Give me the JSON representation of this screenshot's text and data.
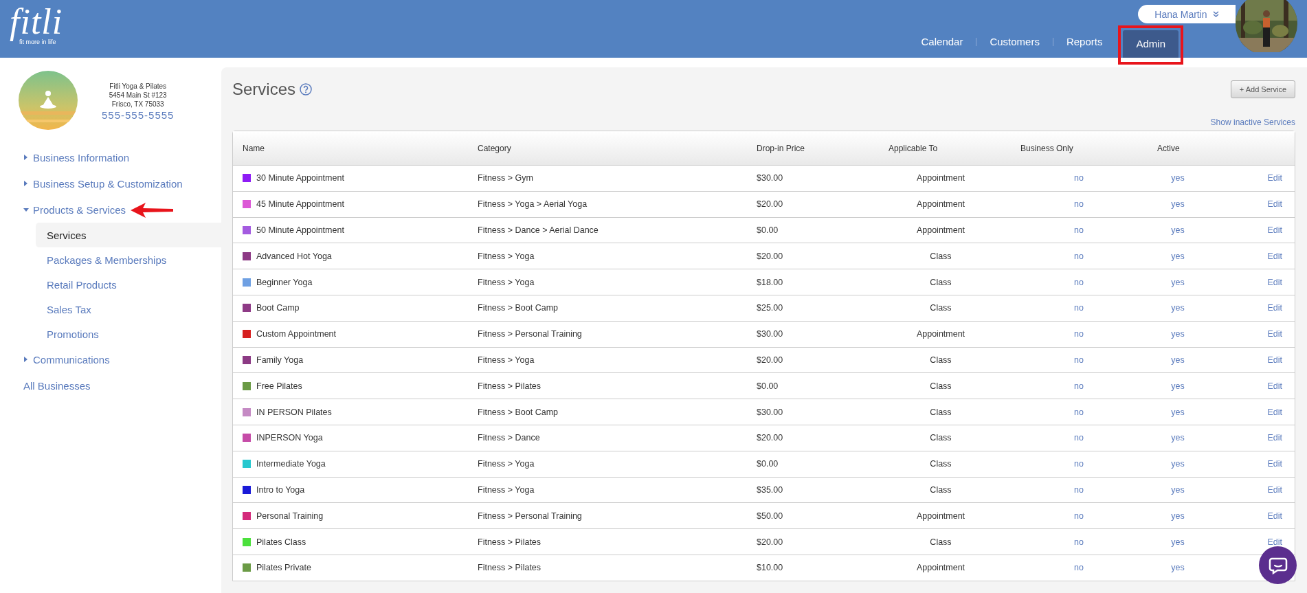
{
  "header": {
    "logo": "fitli",
    "tagline": "fit more in life",
    "user": {
      "name": "Hana Martin"
    },
    "nav": [
      {
        "label": "Calendar",
        "selected": false
      },
      {
        "label": "Customers",
        "selected": false
      },
      {
        "label": "Reports",
        "selected": false
      },
      {
        "label": "Admin",
        "selected": true,
        "highlighted": true
      }
    ]
  },
  "business": {
    "name": "Fitli Yoga & Pilates",
    "address": "5454 Main St #123",
    "city": "Frisco, TX 75033",
    "phone": "555-555-5555"
  },
  "sidebar": {
    "items": [
      {
        "kind": "group",
        "label": "Business Information",
        "expanded": false
      },
      {
        "kind": "group",
        "label": "Business Setup & Customization",
        "expanded": false
      },
      {
        "kind": "group",
        "label": "Products & Services",
        "expanded": true,
        "pointed": true,
        "children": [
          {
            "label": "Services",
            "selected": true
          },
          {
            "label": "Packages & Memberships",
            "selected": false
          },
          {
            "label": "Retail Products",
            "selected": false
          },
          {
            "label": "Sales Tax",
            "selected": false
          },
          {
            "label": "Promotions",
            "selected": false
          }
        ]
      },
      {
        "kind": "group",
        "label": "Communications",
        "expanded": false
      },
      {
        "kind": "link",
        "label": "All Businesses"
      }
    ]
  },
  "page": {
    "title": "Services",
    "add_button": "+ Add Service",
    "inactive_link": "Show inactive Services"
  },
  "table": {
    "columns": [
      "Name",
      "Category",
      "Drop-in Price",
      "Applicable To",
      "Business Only",
      "Active"
    ],
    "rows": [
      {
        "name": "30 Minute Appointment",
        "color": "#8e1cf5",
        "category": "Fitness > Gym",
        "price": "$30.00",
        "applicable": "Appointment",
        "business_only": "no",
        "active": "yes",
        "action": "Edit"
      },
      {
        "name": "45 Minute Appointment",
        "color": "#dc58d6",
        "category": "Fitness > Yoga > Aerial Yoga",
        "price": "$20.00",
        "applicable": "Appointment",
        "business_only": "no",
        "active": "yes",
        "action": "Edit"
      },
      {
        "name": "50 Minute Appointment",
        "color": "#a45be0",
        "category": "Fitness > Dance > Aerial Dance",
        "price": "$0.00",
        "applicable": "Appointment",
        "business_only": "no",
        "active": "yes",
        "action": "Edit"
      },
      {
        "name": "Advanced Hot Yoga",
        "color": "#8d3a85",
        "category": "Fitness > Yoga",
        "price": "$20.00",
        "applicable": "Class",
        "business_only": "no",
        "active": "yes",
        "action": "Edit"
      },
      {
        "name": "Beginner Yoga",
        "color": "#6fa0e3",
        "category": "Fitness > Yoga",
        "price": "$18.00",
        "applicable": "Class",
        "business_only": "no",
        "active": "yes",
        "action": "Edit"
      },
      {
        "name": "Boot Camp",
        "color": "#8e3a86",
        "category": "Fitness > Boot Camp",
        "price": "$25.00",
        "applicable": "Class",
        "business_only": "no",
        "active": "yes",
        "action": "Edit"
      },
      {
        "name": "Custom Appointment",
        "color": "#d62020",
        "category": "Fitness > Personal Training",
        "price": "$30.00",
        "applicable": "Appointment",
        "business_only": "no",
        "active": "yes",
        "action": "Edit"
      },
      {
        "name": "Family Yoga",
        "color": "#8c3a84",
        "category": "Fitness > Yoga",
        "price": "$20.00",
        "applicable": "Class",
        "business_only": "no",
        "active": "yes",
        "action": "Edit"
      },
      {
        "name": "Free Pilates",
        "color": "#6a9a45",
        "category": "Fitness > Pilates",
        "price": "$0.00",
        "applicable": "Class",
        "business_only": "no",
        "active": "yes",
        "action": "Edit"
      },
      {
        "name": "IN PERSON Pilates",
        "color": "#c58ac4",
        "category": "Fitness > Boot Camp",
        "price": "$30.00",
        "applicable": "Class",
        "business_only": "no",
        "active": "yes",
        "action": "Edit"
      },
      {
        "name": "INPERSON Yoga",
        "color": "#c64ca8",
        "category": "Fitness > Dance",
        "price": "$20.00",
        "applicable": "Class",
        "business_only": "no",
        "active": "yes",
        "action": "Edit"
      },
      {
        "name": "Intermediate Yoga",
        "color": "#27c8cf",
        "category": "Fitness > Yoga",
        "price": "$0.00",
        "applicable": "Class",
        "business_only": "no",
        "active": "yes",
        "action": "Edit"
      },
      {
        "name": "Intro to Yoga",
        "color": "#1a1ad8",
        "category": "Fitness > Yoga",
        "price": "$35.00",
        "applicable": "Class",
        "business_only": "no",
        "active": "yes",
        "action": "Edit"
      },
      {
        "name": "Personal Training",
        "color": "#d42a7b",
        "category": "Fitness > Personal Training",
        "price": "$50.00",
        "applicable": "Appointment",
        "business_only": "no",
        "active": "yes",
        "action": "Edit"
      },
      {
        "name": "Pilates Class",
        "color": "#4be03c",
        "category": "Fitness > Pilates",
        "price": "$20.00",
        "applicable": "Class",
        "business_only": "no",
        "active": "yes",
        "action": "Edit"
      },
      {
        "name": "Pilates Private",
        "color": "#6b9b46",
        "category": "Fitness > Pilates",
        "price": "$10.00",
        "applicable": "Appointment",
        "business_only": "no",
        "active": "yes"
      }
    ]
  }
}
